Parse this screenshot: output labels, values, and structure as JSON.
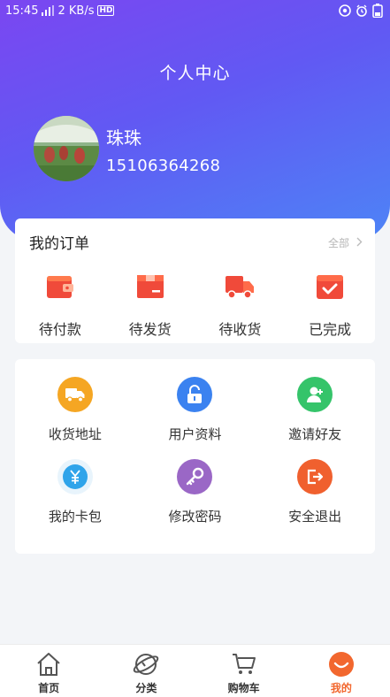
{
  "status_bar": {
    "time": "15:45",
    "network_speed": "2 KB/s",
    "hd_badge": "HD"
  },
  "header": {
    "title": "个人中心"
  },
  "user": {
    "name": "珠珠",
    "phone": "15106364268"
  },
  "orders": {
    "title": "我的订单",
    "all_label": "全部",
    "items": [
      {
        "label": "待付款",
        "icon": "wallet-icon"
      },
      {
        "label": "待发货",
        "icon": "box-icon"
      },
      {
        "label": "待收货",
        "icon": "truck-icon"
      },
      {
        "label": "已完成",
        "icon": "check-box-icon"
      }
    ]
  },
  "services": {
    "items": [
      {
        "label": "收货地址",
        "icon": "truck-icon",
        "color": "#f5a623"
      },
      {
        "label": "用户资料",
        "icon": "lock-icon",
        "color": "#3b82f0"
      },
      {
        "label": "邀请好友",
        "icon": "add-user-icon",
        "color": "#35c46a"
      },
      {
        "label": "我的卡包",
        "icon": "yen-card-icon",
        "color": "#2fa4ea"
      },
      {
        "label": "修改密码",
        "icon": "key-icon",
        "color": "#9a67c6"
      },
      {
        "label": "安全退出",
        "icon": "logout-icon",
        "color": "#f0602e"
      }
    ]
  },
  "tabbar": {
    "items": [
      {
        "label": "首页",
        "icon": "home-icon"
      },
      {
        "label": "分类",
        "icon": "category-icon"
      },
      {
        "label": "购物车",
        "icon": "cart-icon"
      },
      {
        "label": "我的",
        "icon": "profile-icon"
      }
    ],
    "active_index": 3
  },
  "colors": {
    "header_gradient_start": "#7b46f1",
    "header_gradient_end": "#4d84f6",
    "accent_orange": "#f2672e",
    "order_icon_red": "#f04a3a"
  }
}
